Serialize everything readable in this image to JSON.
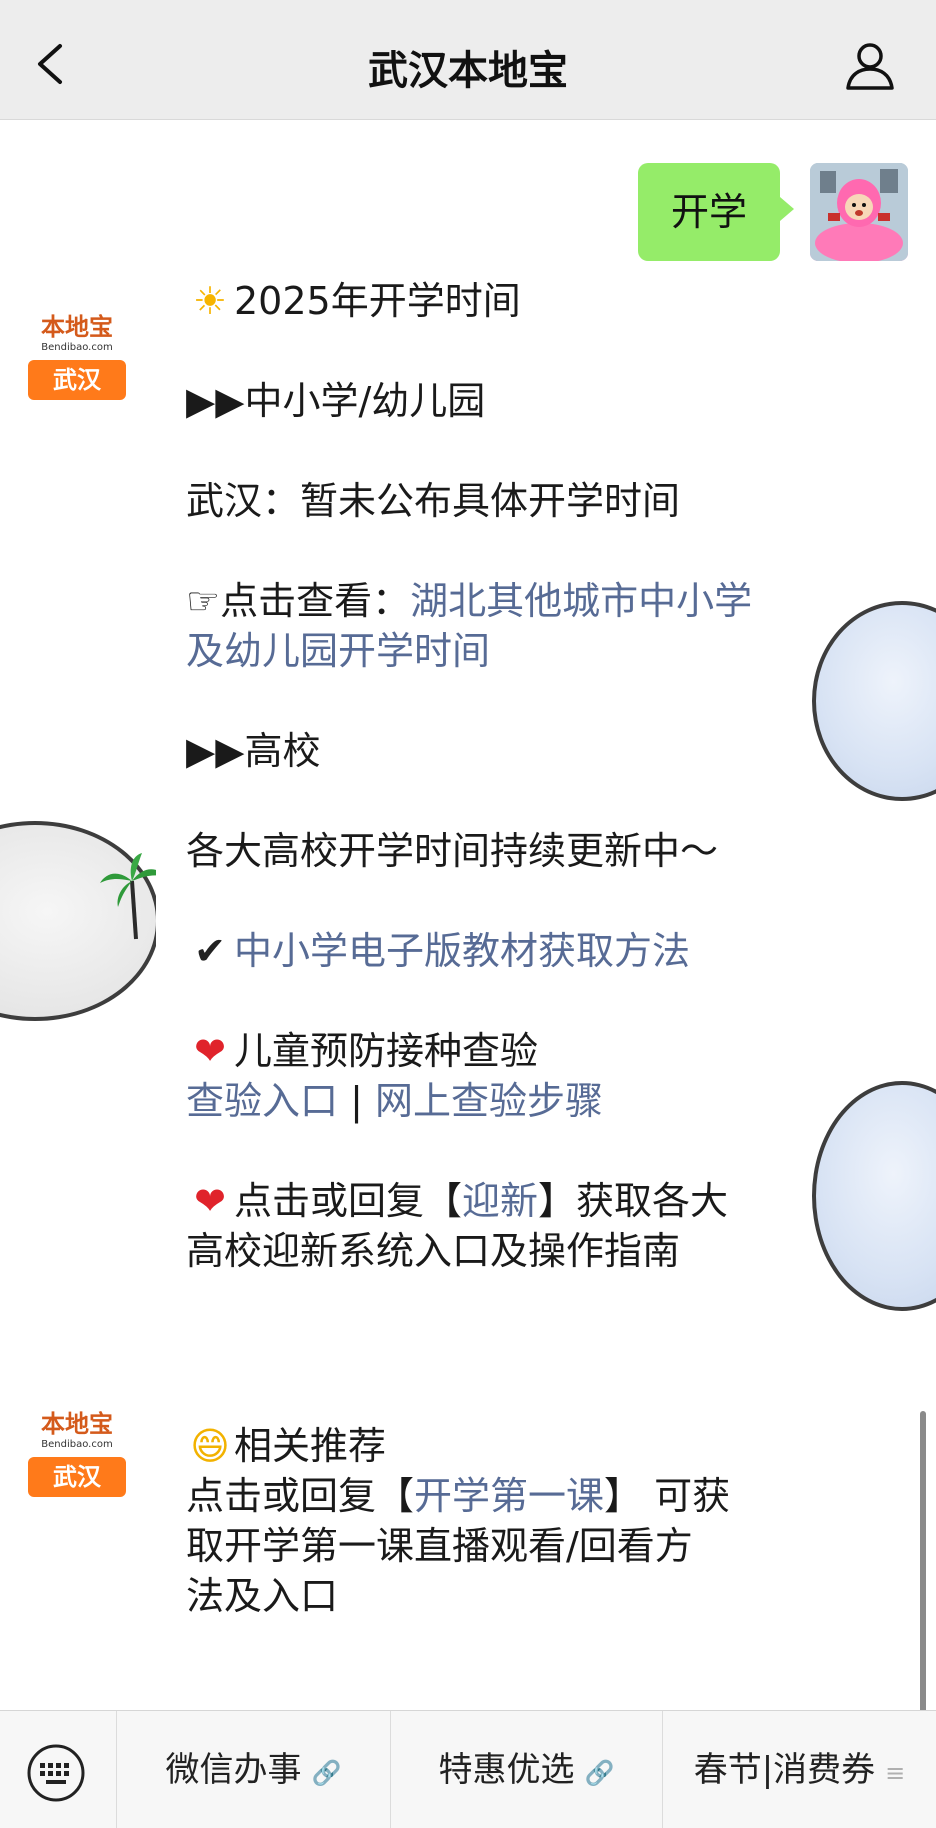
{
  "header": {
    "title": "武汉本地宝"
  },
  "chat": {
    "outgoing_message": "开学",
    "account_logo": {
      "brand": "本地宝",
      "site": "Bendibao.com",
      "city": "武汉"
    },
    "message1": {
      "heading_emoji": "☀",
      "heading": "2025年开学时间",
      "section1_title": "▶▶中小学/幼儿园",
      "wuhan_status": "武汉：暂未公布具体开学时间",
      "click_prefix": "☞点击查看：",
      "other_cities_link_1": "湖北其他城市中小学",
      "other_cities_link_2": "及幼儿园开学时间",
      "section2_title": "▶▶高校",
      "universities_text": "各大高校开学时间持续更新中～",
      "check_emoji": "✔",
      "textbook_link": "中小学电子版教材获取方法",
      "heart_emoji": "❤",
      "vaccine_title": "儿童预防接种查验",
      "vaccine_link_1": "查验入口",
      "vaccine_separator": " | ",
      "vaccine_link_2": "网上查验步骤",
      "welcome_prefix": "点击或回复【",
      "welcome_link": "迎新",
      "welcome_suffix": "】获取各大",
      "welcome_line2": "高校迎新系统入口及操作指南"
    },
    "message2": {
      "emoji": "😄",
      "title": "相关推荐",
      "prefix": "点击或回复【",
      "link": "开学第一课",
      "suffix": "】 可获",
      "line2": "取开学第一课直播观看/回看方",
      "line3": "法及入口"
    }
  },
  "menu": {
    "items": [
      {
        "label": "微信办事",
        "suffix": "🔗"
      },
      {
        "label": "特惠优选",
        "suffix": "🔗"
      },
      {
        "label": "春节|消费券",
        "suffix": "≡"
      }
    ]
  }
}
